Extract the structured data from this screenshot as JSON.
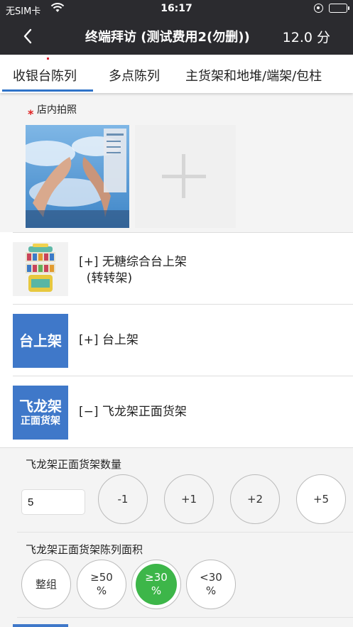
{
  "status_bar": {
    "carrier": "无SIM卡",
    "time": "16:17"
  },
  "nav": {
    "back_icon": "chevron-left-icon",
    "title": "终端拜访 (测试费用2(勿删))",
    "score": "12.0 分"
  },
  "tabs": [
    {
      "label": "收银台陈列",
      "active": true
    },
    {
      "label": "多点陈列",
      "active": false
    },
    {
      "label": "主货架和地堆/端架/包柱",
      "active": false
    }
  ],
  "photo_section": {
    "required_mark": "*",
    "label": "店内拍照"
  },
  "shelves": [
    {
      "label": "[+] 无糖综合台上架\n  (转转架)",
      "thumb_type": "image"
    },
    {
      "label": "[+] 台上架",
      "tile_text_1": "台上架",
      "tile_text_2": ""
    },
    {
      "label": "[−] 飞龙架正面货架",
      "tile_text_1": "飞龙架",
      "tile_text_2": "正面货架"
    }
  ],
  "quantity": {
    "title": "飞龙架正面货架数量",
    "value": "5",
    "buttons": [
      "-1",
      "+1",
      "+2",
      "+5"
    ]
  },
  "area": {
    "title": "飞龙架正面货架陈列面积",
    "options": [
      "整组",
      "≥50\n%",
      "≥30\n%",
      "<30\n%"
    ],
    "selected": "≥30\n%"
  },
  "colors": {
    "topbar": "#2b2b2f",
    "accent_blue": "#2f73c8",
    "selected_green": "#3db649"
  }
}
